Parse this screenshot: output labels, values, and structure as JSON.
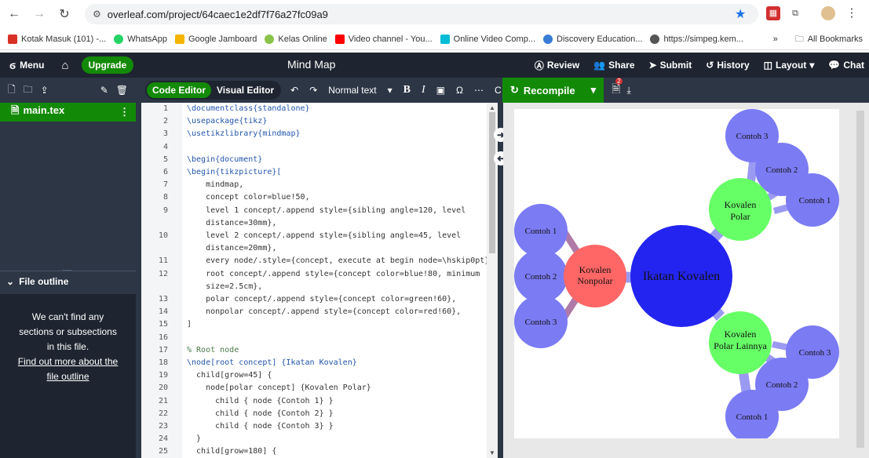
{
  "browser": {
    "url": "overleaf.com/project/64caec1e2df7f76a27fc09a9",
    "bookmarks": [
      "Kotak Masuk (101) -...",
      "WhatsApp",
      "Google Jamboard",
      "Kelas Online",
      "Video channel - You...",
      "Online Video Comp...",
      "Discovery Education...",
      "https://simpeg.kem..."
    ],
    "all_bookmarks": "All Bookmarks",
    "overflow": "»"
  },
  "toolbar": {
    "menu": "Menu",
    "upgrade": "Upgrade",
    "project_title": "Mind Map",
    "review": "Review",
    "share": "Share",
    "submit": "Submit",
    "history": "History",
    "layout": "Layout",
    "chat": "Chat"
  },
  "editor_bar": {
    "code_editor": "Code Editor",
    "visual_editor": "Visual Editor",
    "text_style": "Normal text",
    "recompile": "Recompile",
    "log_badge": "2"
  },
  "sidebar": {
    "file": "main.tex",
    "outline_title": "File outline",
    "outline_msg_1": "We can't find any",
    "outline_msg_2": "sections or subsections",
    "outline_msg_3": "in this file.",
    "outline_link_1": "Find out more about the",
    "outline_link_2": "file outline"
  },
  "code_lines": [
    {
      "n": "1",
      "t": "\\documentclass{standalone}"
    },
    {
      "n": "2",
      "t": "\\usepackage{tikz}"
    },
    {
      "n": "3",
      "t": "\\usetikzlibrary{mindmap}"
    },
    {
      "n": "4",
      "t": ""
    },
    {
      "n": "5",
      "t": "\\begin{document}"
    },
    {
      "n": "6",
      "t": "\\begin{tikzpicture}["
    },
    {
      "n": "7",
      "t": "    mindmap,"
    },
    {
      "n": "8",
      "t": "    concept color=blue!50,"
    },
    {
      "n": "9",
      "t": "    level 1 concept/.append style={sibling angle=120, level"
    },
    {
      "n": "",
      "t": "    distance=30mm},"
    },
    {
      "n": "10",
      "t": "    level 2 concept/.append style={sibling angle=45, level"
    },
    {
      "n": "",
      "t": "    distance=20mm},"
    },
    {
      "n": "11",
      "t": "    every node/.style={concept, execute at begin node=\\hskip0pt},"
    },
    {
      "n": "12",
      "t": "    root concept/.append style={concept color=blue!80, minimum"
    },
    {
      "n": "",
      "t": "    size=2.5cm},"
    },
    {
      "n": "13",
      "t": "    polar concept/.append style={concept color=green!60},"
    },
    {
      "n": "14",
      "t": "    nonpolar concept/.append style={concept color=red!60},"
    },
    {
      "n": "15",
      "t": "]"
    },
    {
      "n": "16",
      "t": ""
    },
    {
      "n": "17",
      "t": "% Root node"
    },
    {
      "n": "18",
      "t": "\\node[root concept] {Ikatan Kovalen}"
    },
    {
      "n": "19",
      "t": "  child[grow=45] {"
    },
    {
      "n": "20",
      "t": "    node[polar concept] {Kovalen Polar}"
    },
    {
      "n": "21",
      "t": "      child { node {Contoh 1} }"
    },
    {
      "n": "22",
      "t": "      child { node {Contoh 2} }"
    },
    {
      "n": "23",
      "t": "      child { node {Contoh 3} }"
    },
    {
      "n": "24",
      "t": "  }"
    },
    {
      "n": "25",
      "t": "  child[grow=180] {"
    }
  ],
  "mindmap": {
    "root": "Ikatan Kovalen",
    "polar_1": "Kovalen",
    "polar_2": "Polar",
    "nonpolar_1": "Kovalen",
    "nonpolar_2": "Nonpolar",
    "polar_other_1": "Kovalen",
    "polar_other_2": "Polar Lainnya",
    "c1": "Contoh 1",
    "c2": "Contoh 2",
    "c3": "Contoh 3"
  },
  "colors": {
    "accent": "#138a07",
    "dark": "#1e2530",
    "panel": "#2c3645",
    "blue": "#2424f0",
    "green": "#66ff66",
    "red": "#ff6666",
    "lightblue": "#7b7bf4"
  }
}
